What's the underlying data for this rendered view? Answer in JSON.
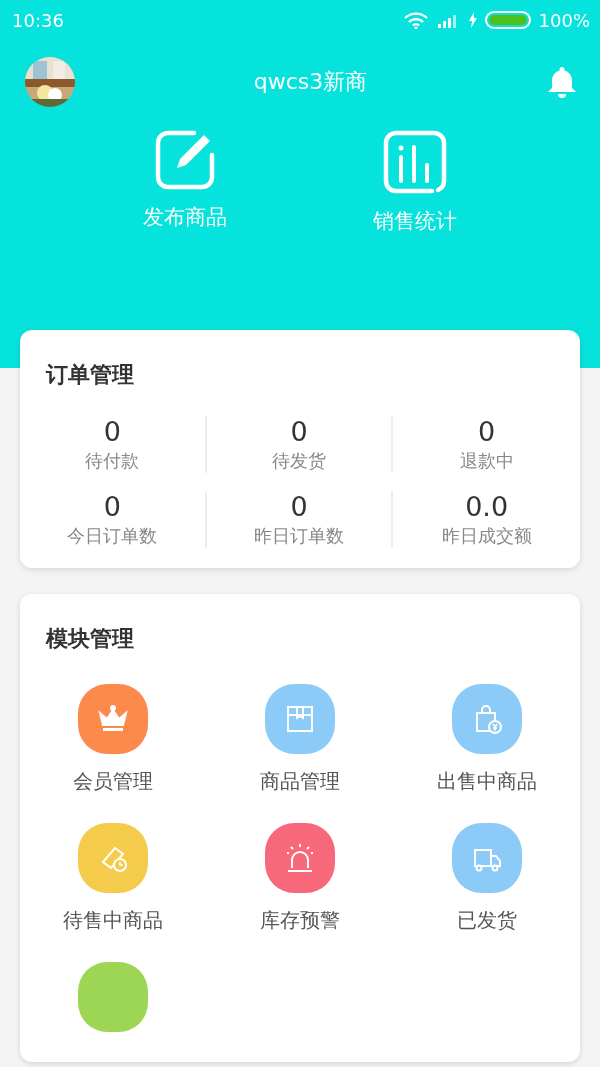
{
  "status_bar": {
    "time": "10:36",
    "battery": "100%"
  },
  "header": {
    "title": "qwcs3新商"
  },
  "actions": [
    {
      "kind": "edit",
      "label": "发布商品"
    },
    {
      "kind": "stats",
      "label": "销售统计"
    }
  ],
  "orders": {
    "title": "订单管理",
    "stats": [
      {
        "value": "0",
        "label": "待付款"
      },
      {
        "value": "0",
        "label": "待发货"
      },
      {
        "value": "0",
        "label": "退款中"
      },
      {
        "value": "0",
        "label": "今日订单数"
      },
      {
        "value": "0",
        "label": "昨日订单数"
      },
      {
        "value": "0.0",
        "label": "昨日成交额"
      }
    ]
  },
  "modules": {
    "title": "模块管理",
    "items": [
      {
        "kind": "crown",
        "color": "#fb8a4b",
        "label": "会员管理"
      },
      {
        "kind": "box",
        "color": "#8ccbf7",
        "label": "商品管理"
      },
      {
        "kind": "bag",
        "color": "#8ccbf7",
        "label": "出售中商品"
      },
      {
        "kind": "tag",
        "color": "#f5cb4c",
        "label": "待售中商品"
      },
      {
        "kind": "alarm",
        "color": "#f7687a",
        "label": "库存预警"
      },
      {
        "kind": "truck",
        "color": "#8ccbf7",
        "label": "已发货"
      },
      {
        "kind": "blank",
        "color": "#9dd654"
      }
    ]
  }
}
